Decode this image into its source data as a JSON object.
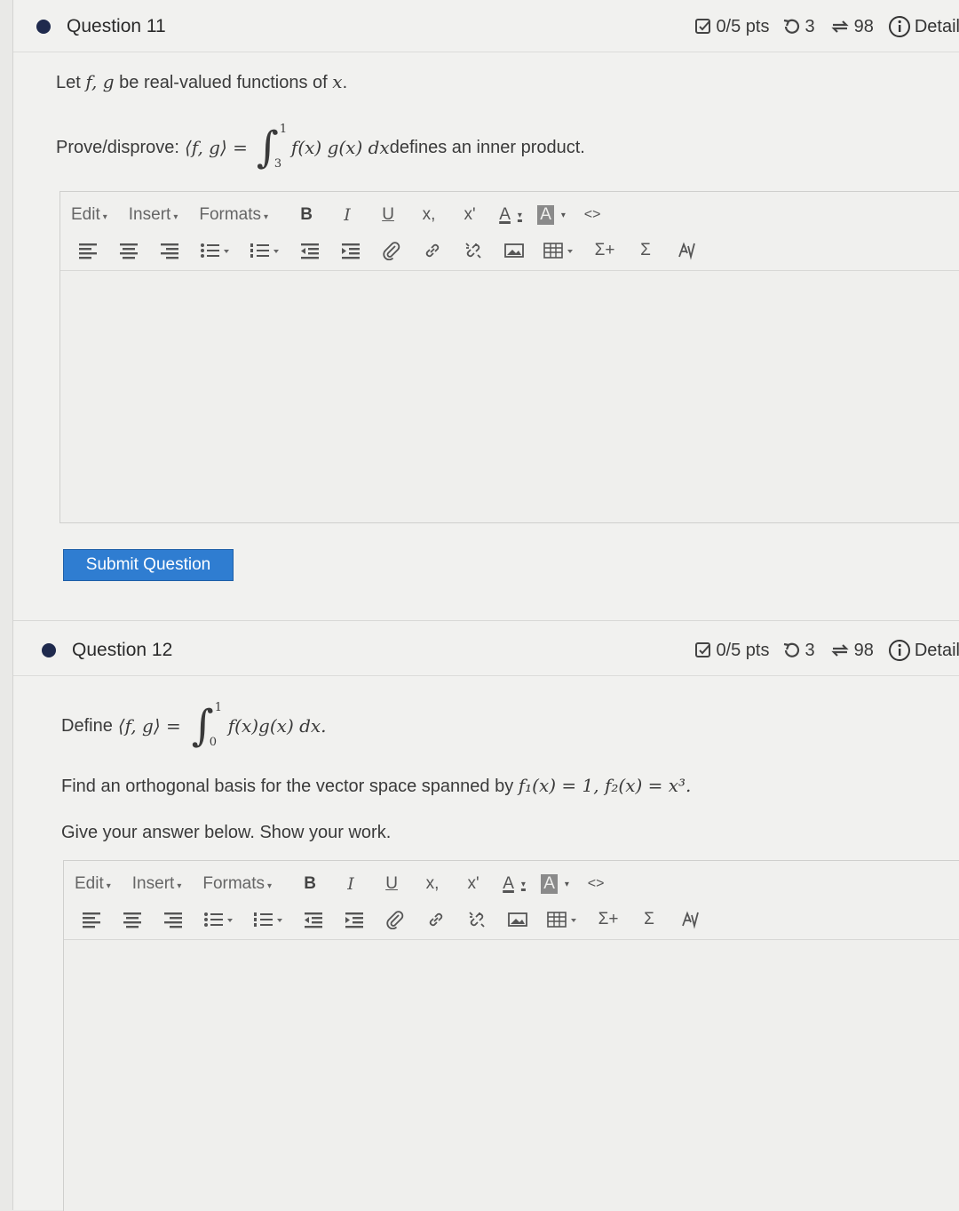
{
  "question11": {
    "title": "Question 11",
    "points": "0/5 pts",
    "attempts": "3",
    "submissions": "98",
    "details_label": "Detail",
    "intro_prefix": "Let ",
    "intro_math": "f, g",
    "intro_mid": " be real-valued functions of ",
    "intro_var": "x",
    "intro_end": ".",
    "prove_label": "Prove/disprove: ",
    "prove_lhs": "⟨f, g⟩ =",
    "integral_upper": "1",
    "integral_lower": "3",
    "prove_integrand": "f(x) g(x) dx",
    "prove_tail": " defines an inner product.",
    "submit_label": "Submit Question"
  },
  "question12": {
    "title": "Question 12",
    "points": "0/5 pts",
    "attempts": "3",
    "submissions": "98",
    "details_label": "Detail",
    "define_label": "Define ",
    "define_lhs": "⟨f, g⟩ =",
    "integral_upper": "1",
    "integral_lower": "0",
    "define_integrand": "f(x)g(x) dx.",
    "find_prefix": "Find an orthogonal basis for the vector space spanned by ",
    "find_math": "f₁(x) = 1, f₂(x) = x³.",
    "give_text": "Give your answer below. Show your work."
  },
  "editor": {
    "menu_edit": "Edit",
    "menu_insert": "Insert",
    "menu_formats": "Formats",
    "bold": "B",
    "italic": "I",
    "underline": "U",
    "subscript": "x,",
    "superscript": "x'",
    "font_color": "A",
    "bg_color": "A",
    "code": "<>",
    "sum_plus": "Σ+",
    "sum": "Σ"
  },
  "colors": {
    "submit_bg": "#2f7dd1",
    "bullet": "#1f2a4d"
  }
}
